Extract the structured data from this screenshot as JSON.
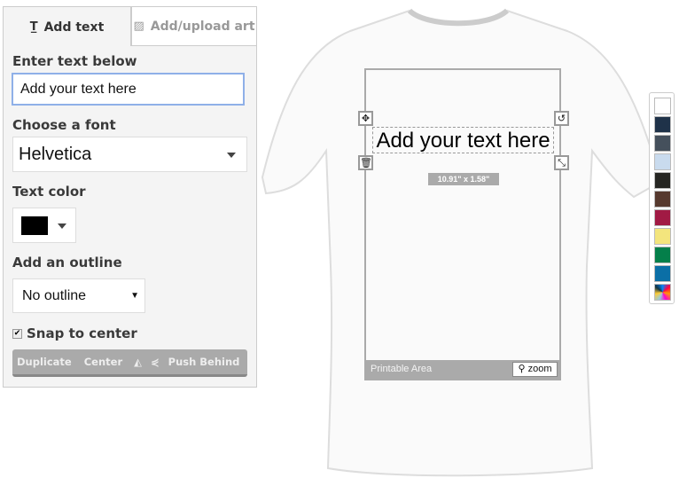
{
  "tabs": [
    {
      "label": "Add text",
      "icon": "text-icon",
      "active": true
    },
    {
      "label": "Add/upload art",
      "icon": "image-icon",
      "active": false
    }
  ],
  "text_section": {
    "label": "Enter text below",
    "value": "Add your text here"
  },
  "font_section": {
    "label": "Choose a font",
    "value": "Helvetica"
  },
  "color_section": {
    "label": "Text color",
    "value": "#000000"
  },
  "outline_section": {
    "label": "Add an outline",
    "value": "No outline"
  },
  "snap": {
    "label": "Snap to center",
    "checked": true
  },
  "toolbar": {
    "duplicate": "Duplicate",
    "center": "Center",
    "flip_icon": "flip-icon",
    "rotate_icon": "mirror-icon",
    "push_behind": "Push Behind"
  },
  "canvas": {
    "text": "Add your text here",
    "dimensions": "10.91\" x 1.58\"",
    "printable_area": "Printable Area",
    "zoom": "zoom"
  },
  "swatches": [
    "#ffffff",
    "#1f3249",
    "#45505c",
    "#c9dbee",
    "#262622",
    "#56392e",
    "#a11a44",
    "#f3e57d",
    "#047f4a",
    "#0b6fa6"
  ],
  "multicolor_icon": "palette-icon"
}
